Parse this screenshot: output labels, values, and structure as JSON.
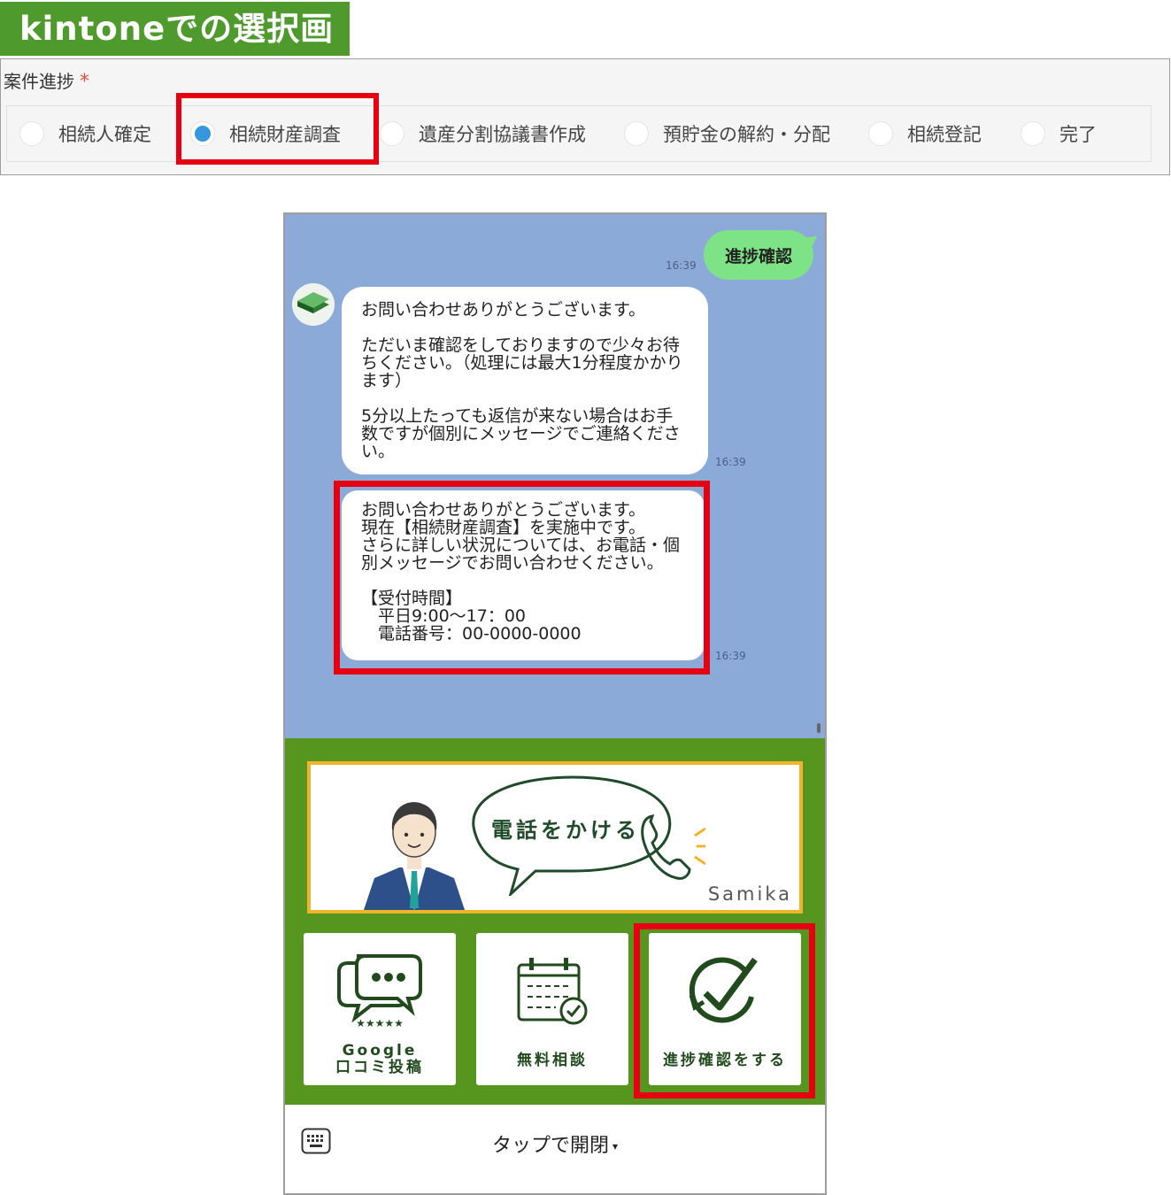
{
  "banner": {
    "title": "kintoneでの選択画面"
  },
  "field": {
    "label": "案件進捗",
    "required_mark": "*",
    "options": [
      {
        "label": "相続人確定",
        "selected": false
      },
      {
        "label": "相続財産調査",
        "selected": true
      },
      {
        "label": "遺産分割協議書作成",
        "selected": false
      },
      {
        "label": "預貯金の解約・分配",
        "selected": false
      },
      {
        "label": "相続登記",
        "selected": false
      },
      {
        "label": "完了",
        "selected": false
      }
    ]
  },
  "chat": {
    "user_message": {
      "text": "進捗確認",
      "time": "16:39"
    },
    "bot_message_1": {
      "text": "お問い合わせありがとうございます。\n\nただいま確認をしておりますので少々お待ちください。（処理には最大1分程度かかります）\n\n5分以上たっても返信が来ない場合はお手数ですが個別にメッセージでご連絡ください。",
      "time": "16:39"
    },
    "bot_message_2": {
      "text": "お問い合わせありがとうございます。\n現在【相続財産調査】を実施中です。\nさらに詳しい状況については、お電話・個別メッセージでお問い合わせください。\n\n【受付時間】\n　平日9:00〜17：00\n　電話番号：00-0000-0000",
      "time": "16:39"
    }
  },
  "richmenu": {
    "call": {
      "label": "電話をかける",
      "brand": "Samika"
    },
    "tiles": [
      {
        "label_line1": "Google",
        "label_line2": "口コミ投稿",
        "icon": "review-chat-icon"
      },
      {
        "label": "無料相談",
        "icon": "calendar-check-icon"
      },
      {
        "label": "進捗確認をする",
        "icon": "check-circle-icon"
      }
    ]
  },
  "bottombar": {
    "label": "タップで開閉",
    "caret": "▾"
  },
  "colors": {
    "banner_green": "#4f9a2d",
    "chat_background": "#8caad8",
    "user_bubble": "#7ee386",
    "menu_green": "#56961f",
    "highlight_red": "#e60012",
    "radio_selected": "#3498db"
  }
}
